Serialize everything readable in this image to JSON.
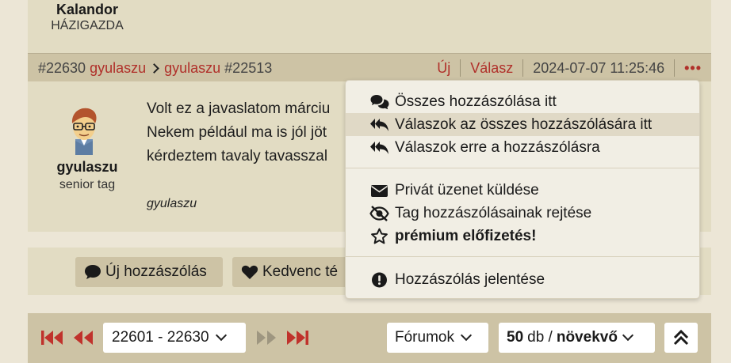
{
  "top_author": {
    "name": "Kalandor",
    "rank": "HÁZIGAZDA"
  },
  "post_header": {
    "post_id": "#22630",
    "author": "gyulaszu",
    "reply_to_author": "gyulaszu",
    "reply_to_id": "#22513",
    "new_label": "Új",
    "reply_label": "Válasz",
    "timestamp": "2024-07-07 11:25:46",
    "more_label": "•••"
  },
  "post": {
    "author_name": "gyulaszu",
    "author_rank": "senior tag",
    "lines": [
      "Volt ez a javaslatom márciu",
      "Nekem például ma is jól jöt",
      "kérdeztem tavaly tavasszal"
    ],
    "signature": "gyulaszu"
  },
  "actions": {
    "new_post_label": "Új hozzászólás",
    "favorite_label": "Kedvenc té"
  },
  "menu": {
    "items": [
      {
        "label": "Összes hozzászólása itt",
        "icon": "comments-icon"
      },
      {
        "label": "Válaszok az összes hozzászólására itt",
        "icon": "reply-all-icon"
      },
      {
        "label": "Válaszok erre a hozzászólásra",
        "icon": "reply-icon"
      },
      {
        "label": "Privát üzenet küldése",
        "icon": "envelope-icon"
      },
      {
        "label": "Tag hozzászólásainak rejtése",
        "icon": "eye-slash-icon"
      },
      {
        "label": "prémium előfizetés!",
        "icon": "star-icon"
      },
      {
        "label": "Hozzászólás jelentése",
        "icon": "exclamation-icon"
      }
    ]
  },
  "pager": {
    "range": "22601 - 22630",
    "forums_label": "Fórumok",
    "per_page": "50",
    "per_page_unit": "db /",
    "sort": "növekvő"
  },
  "colors": {
    "accent": "#b0302a",
    "header_bg": "#cdc3a5",
    "card_bg": "#e2dcc3",
    "page_bg": "#ece6d6"
  }
}
